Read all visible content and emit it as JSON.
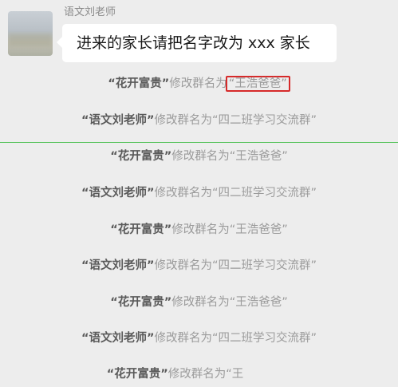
{
  "chat": {
    "sender_name": "语文刘老师",
    "message_text": "进来的家长请把名字改为 xxx 家长"
  },
  "notices": [
    {
      "actor": "“花开富贵”",
      "action": "修改群名为",
      "target": "“王浩爸爸”",
      "highlighted": true
    },
    {
      "actor": "“语文刘老师”",
      "action": "修改群名为",
      "target": "“四二班学习交流群”",
      "highlighted": false
    },
    {
      "actor": "“花开富贵”",
      "action": "修改群名为",
      "target": "“王浩爸爸”",
      "highlighted": false
    },
    {
      "actor": "“语文刘老师”",
      "action": "修改群名为",
      "target": "“四二班学习交流群”",
      "highlighted": false
    },
    {
      "actor": "“花开富贵”",
      "action": "修改群名为",
      "target": "“王浩爸爸”",
      "highlighted": false
    },
    {
      "actor": "“语文刘老师”",
      "action": "修改群名为",
      "target": "“四二班学习交流群”",
      "highlighted": false
    },
    {
      "actor": "“花开富贵”",
      "action": "修改群名为",
      "target": "“王浩爸爸”",
      "highlighted": false
    },
    {
      "actor": "“语文刘老师”",
      "action": "修改群名为",
      "target": "“四二班学习交流群”",
      "highlighted": false
    },
    {
      "actor": "“花开富贵”",
      "action": "修改群名为",
      "target": "“王",
      "highlighted": false
    }
  ],
  "colors": {
    "highlight_border": "#d62a2a",
    "divider_line": "#55c25b",
    "background": "#ededed",
    "bubble": "#ffffff"
  }
}
